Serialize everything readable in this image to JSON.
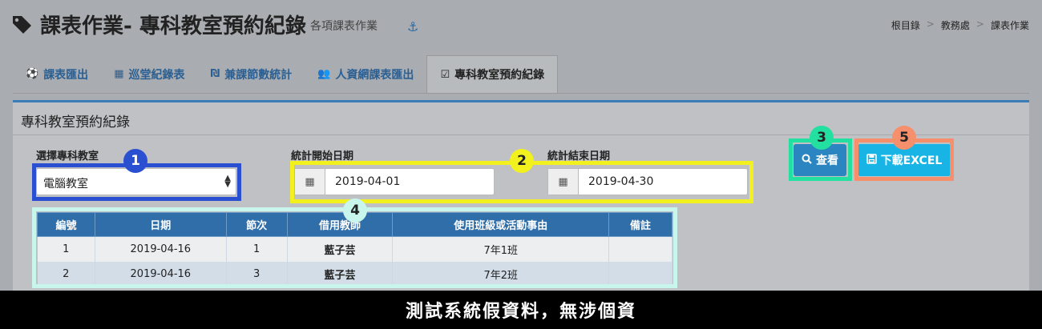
{
  "header": {
    "title": "課表作業- 專科教室預約紀錄",
    "subtitle": "各項課表作業",
    "breadcrumb": [
      "根目錄",
      "教務處",
      "課表作業"
    ],
    "breadcrumb_sep": ">"
  },
  "tabs": [
    {
      "label": "課表匯出",
      "icon": "soccer-ball-icon",
      "glyph": "⚽"
    },
    {
      "label": "巡堂紀錄表",
      "icon": "calendar-icon",
      "glyph": "▦"
    },
    {
      "label": "兼課節數統計",
      "icon": "currency-icon",
      "glyph": "₪"
    },
    {
      "label": "人資網課表匯出",
      "icon": "users-icon",
      "glyph": "👥"
    },
    {
      "label": "專科教室預約紀錄",
      "icon": "calendar-check-icon",
      "glyph": "☑"
    }
  ],
  "panel": {
    "title": "專科教室預約紀錄",
    "classroom_label": "選擇專科教室",
    "classroom_value": "電腦教室",
    "start_label": "統計開始日期",
    "start_value": "2019-04-01",
    "end_label": "統計結束日期",
    "end_value": "2019-04-30",
    "view_button": "查看",
    "excel_button": "下載EXCEL"
  },
  "badges": [
    "1",
    "2",
    "3",
    "4",
    "5"
  ],
  "table": {
    "headers": [
      "編號",
      "日期",
      "節次",
      "借用教師",
      "使用班級或活動事由",
      "備註"
    ],
    "rows": [
      [
        "1",
        "2019-04-16",
        "1",
        "藍子芸",
        "7年1班",
        ""
      ],
      [
        "2",
        "2019-04-16",
        "3",
        "藍子芸",
        "7年2班",
        ""
      ]
    ]
  },
  "caption": "測試系統假資料，無涉個資",
  "colors": {
    "accent": "#2f6ea8",
    "highlight_1": "#2a4fd0",
    "highlight_2": "#f2f01e",
    "highlight_3": "#23e0a0",
    "highlight_4": "#c9f6ec",
    "highlight_5": "#f58f6c"
  }
}
